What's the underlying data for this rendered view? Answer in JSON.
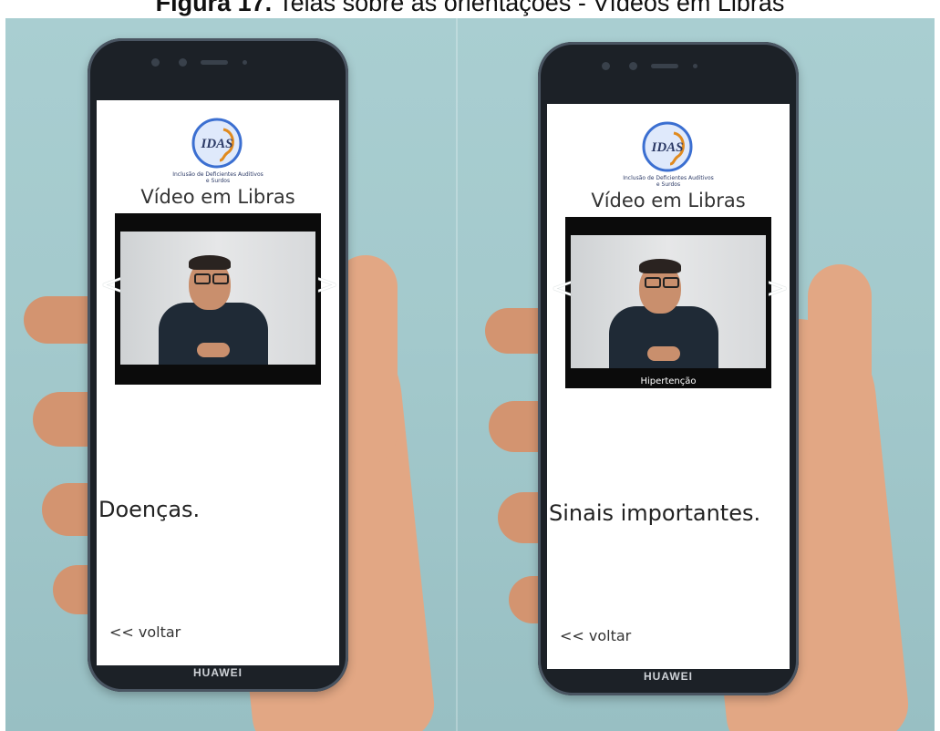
{
  "caption": {
    "label": "Figura 17.",
    "text": " Telas sobre as orientações - Vídeos em Libras"
  },
  "phones": [
    {
      "brand": "HUAWEI",
      "logo_text": "IDAS",
      "logo_sub": "Inclusão de Deficientes Auditivos e Surdos",
      "title": "Vídeo em Libras",
      "prev_arrow": "<",
      "next_arrow": ">",
      "video_caption": "",
      "section_text": "Doenças.",
      "back_label": "<< voltar"
    },
    {
      "brand": "HUAWEI",
      "logo_text": "IDAS",
      "logo_sub": "Inclusão de Deficientes Auditivos e Surdos",
      "title": "Vídeo em Libras",
      "prev_arrow": "<",
      "next_arrow": ">",
      "video_caption": "Hipertenção",
      "section_text": "Sinais importantes.",
      "back_label": "<< voltar"
    }
  ],
  "colors": {
    "background": "#a6cccf",
    "phone_body": "#1c2127",
    "screen": "#ffffff",
    "logo_ring": "#3b6fd1",
    "logo_accent": "#e08a1e"
  }
}
